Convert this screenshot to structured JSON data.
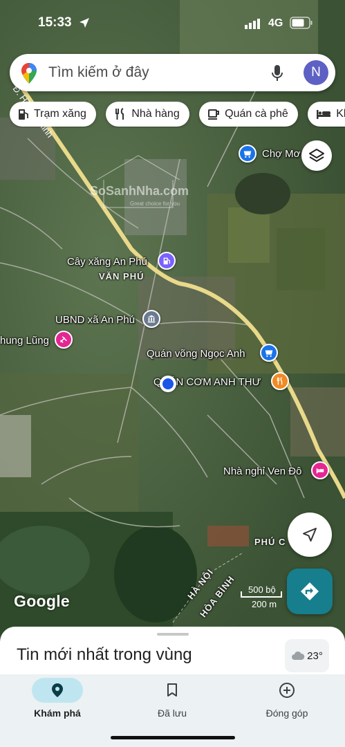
{
  "status_bar": {
    "time": "15:33",
    "network": "4G"
  },
  "search": {
    "placeholder": "Tìm kiếm ở đây",
    "avatar_letter": "N"
  },
  "chips": [
    {
      "label": "Trạm xăng",
      "icon": "gas-station-icon"
    },
    {
      "label": "Nhà hàng",
      "icon": "restaurant-icon"
    },
    {
      "label": "Quán cà phê",
      "icon": "coffee-icon"
    },
    {
      "label": "Kh",
      "icon": "hotel-icon"
    }
  ],
  "map": {
    "pois": [
      {
        "label": "Chợ Mơ... phú",
        "visible_label": "Chợ Mơ",
        "icon": "shopping-icon",
        "color": "#1a73e8"
      },
      {
        "label": "Cây xăng An Phú",
        "icon": "gas-station-icon",
        "color": "#7b61ff"
      },
      {
        "label": "UBND xã An Phú",
        "icon": "government-icon",
        "color": "#6b7a8f"
      },
      {
        "label": "hung Lũng",
        "icon": "spa-icon",
        "color": "#e52592"
      },
      {
        "label": "Quán võng Ngọc Anh",
        "icon": "shopping-icon",
        "color": "#1a73e8"
      },
      {
        "label": "QUÁN CƠM ANH THƯ",
        "icon": "restaurant-icon",
        "color": "#f08a24"
      },
      {
        "label": "Nhà nghỉ Ven Đô",
        "icon": "hotel-icon",
        "color": "#e52592"
      }
    ],
    "areas": [
      "VĂN PHÚ",
      "PHÚ C",
      "HÀ NỘI",
      "HÒA BÌNH"
    ],
    "road_labels": [
      "Đ. Hồ Chí Minh"
    ],
    "attribution": "Google",
    "watermark": "SoSanhNha.com",
    "watermark_tagline": "Great choice for you",
    "scale": {
      "imperial": "500 bộ",
      "metric": "200 m"
    }
  },
  "sheet": {
    "title": "Tin mới nhất trong vùng",
    "temperature": "23°"
  },
  "nav": [
    {
      "label": "Khám phá",
      "icon": "explore-pin-icon",
      "active": true
    },
    {
      "label": "Đã lưu",
      "icon": "bookmark-icon",
      "active": false
    },
    {
      "label": "Đóng góp",
      "icon": "add-circle-icon",
      "active": false
    }
  ],
  "colors": {
    "accent": "#167e8c",
    "nav_active": "#bfe6f0",
    "avatar": "#5e61c3",
    "road": "#e9d98a",
    "location_dot": "#1a56e8"
  }
}
